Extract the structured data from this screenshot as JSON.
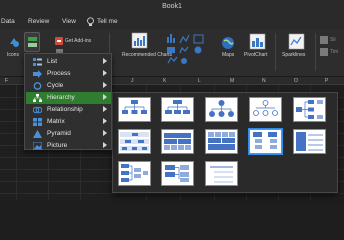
{
  "window": {
    "title": "Book1"
  },
  "menu_bar": {
    "items": [
      "Data",
      "Review",
      "View"
    ],
    "tell_me": "Tell me"
  },
  "ribbon": {
    "icons_label": "Icons",
    "add_ins_label": "Get Add-ins",
    "recommended_charts_label": "Recommended Charts",
    "maps_label": "Maps",
    "pivotchart_label": "PivotChart",
    "sparklines_label": "Sparklines",
    "partial_labels": [
      "Sli",
      "Tim"
    ]
  },
  "grid": {
    "columns": [
      "F",
      "J",
      "K",
      "L",
      "M",
      "N",
      "O",
      "P"
    ]
  },
  "smartart_menu": {
    "items": [
      {
        "label": "List",
        "icon": "list-icon"
      },
      {
        "label": "Process",
        "icon": "process-icon"
      },
      {
        "label": "Cycle",
        "icon": "cycle-icon"
      },
      {
        "label": "Hierarchy",
        "icon": "hierarchy-icon"
      },
      {
        "label": "Relationship",
        "icon": "relationship-icon"
      },
      {
        "label": "Matrix",
        "icon": "matrix-icon"
      },
      {
        "label": "Pyramid",
        "icon": "pyramid-icon"
      },
      {
        "label": "Picture",
        "icon": "picture-icon"
      }
    ],
    "active_item": "Hierarchy"
  },
  "colors": {
    "accent": "#2f7d2f",
    "selection": "#2f8be6",
    "diagram_blue": "#4472c4"
  }
}
